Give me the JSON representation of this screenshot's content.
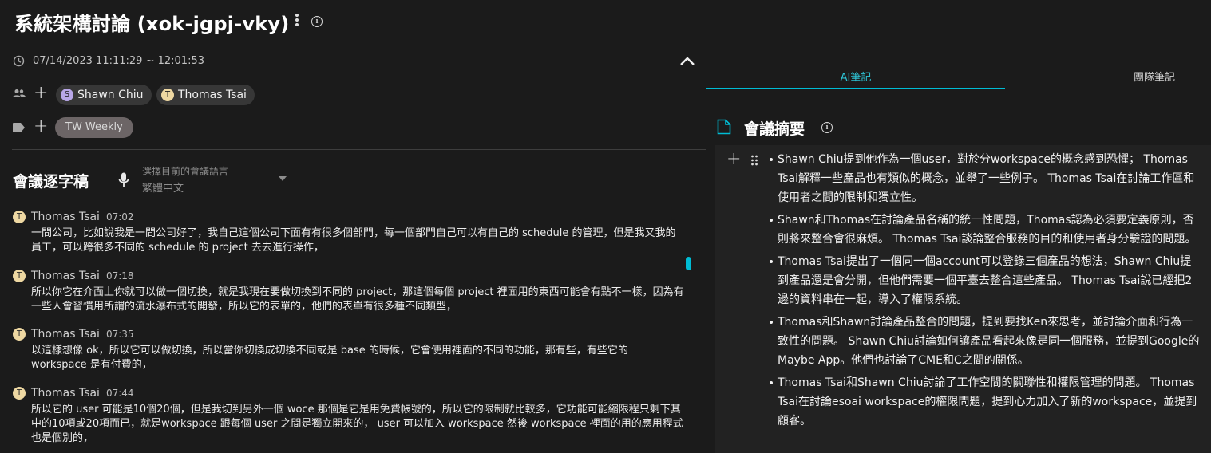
{
  "header": {
    "title": "系統架構討論 (xok-jgpj-vky)"
  },
  "meeting": {
    "datetime": "07/14/2023 11:11:29 ~ 12:01:53",
    "participants": [
      {
        "initial": "S",
        "name": "Shawn Chiu",
        "color": "#b8a6e8"
      },
      {
        "initial": "T",
        "name": "Thomas Tsai",
        "color": "#eed8a2"
      }
    ],
    "tags": [
      "TW Weekly"
    ]
  },
  "transcript": {
    "title": "會議逐字稿",
    "language_label": "選擇目前的會議語言",
    "language_value": "繁體中文",
    "entries": [
      {
        "initial": "T",
        "speaker": "Thomas Tsai",
        "time": "07:02",
        "text": "一間公司，比如說我是一間公司好了，我自己這個公司下面有有很多個部門，每一個部門自己可以有自己的 schedule 的管理，但是我又我的員工，可以跨很多不同的 schedule 的 project 去去進行操作，"
      },
      {
        "initial": "T",
        "speaker": "Thomas Tsai",
        "time": "07:18",
        "text": "所以你它在介面上你就可以做一個切換，就是我現在要做切換到不同的 project，那這個每個 project 裡面用的東西可能會有點不一樣，因為有一些人會習慣用所謂的流水瀑布式的開發，所以它的表單的，他們的表單有很多種不同類型，"
      },
      {
        "initial": "T",
        "speaker": "Thomas Tsai",
        "time": "07:35",
        "text": "以這樣想像 ok，所以它可以做切換，所以當你切換成切換不同或是 base 的時候，它會使用裡面的不同的功能，那有些，有些它的 workspace 是有付費的，"
      },
      {
        "initial": "T",
        "speaker": "Thomas Tsai",
        "time": "07:44",
        "text": "所以它的 user 可能是10個20個，但是我切到另外一個 woce 那個是它是用免費帳號的，所以它的限制就比較多，它功能可能縮限程只剩下其中的10項或20項而已，就是workspace 跟每個 user 之間是獨立開來的， user 可以加入 workspace 然後 workspace 裡面的用的應用程式也是個別的，"
      }
    ]
  },
  "right_panel": {
    "tabs": [
      {
        "label": "AI筆記",
        "active": true
      },
      {
        "label": "團隊筆記",
        "active": false
      }
    ],
    "summary_title": "會議摘要",
    "summary_items": [
      "Shawn Chiu提到他作為一個user，對於分workspace的概念感到恐懼； Thomas Tsai解釋一些產品也有類似的概念，並舉了一些例子。 Thomas Tsai在討論工作區和使用者之間的限制和獨立性。",
      "Shawn和Thomas在討論產品名稱的統一性問題，Thomas認為必須要定義原則，否則將來整合會很麻煩。 Thomas Tsai談論整合服務的目的和使用者身分驗證的問題。",
      "Thomas Tsai提出了一個同一個account可以登錄三個產品的想法，Shawn Chiu提到產品還是會分開，但他們需要一個平臺去整合這些產品。 Thomas Tsai說已經把2邊的資料串在一起，導入了權限系統。",
      "Thomas和Shawn討論產品整合的問題，提到要找Ken來思考，並討論介面和行為一致性的問題。 Shawn Chiu討論如何讓產品看起來像是同一個服務，並提到Google的Maybe App。他們也討論了CME和C之間的關係。",
      "Thomas Tsai和Shawn Chiu討論了工作空間的關聯性和權限管理的問題。 Thomas Tsai在討論esoai workspace的權限問題，提到心力加入了新的workspace，並提到顧客。"
    ]
  },
  "colors": {
    "accent": "#00bcd4",
    "tab_active_text": "#2ec4d6",
    "background": "#1b1b1b",
    "summary_background": "#222222"
  }
}
